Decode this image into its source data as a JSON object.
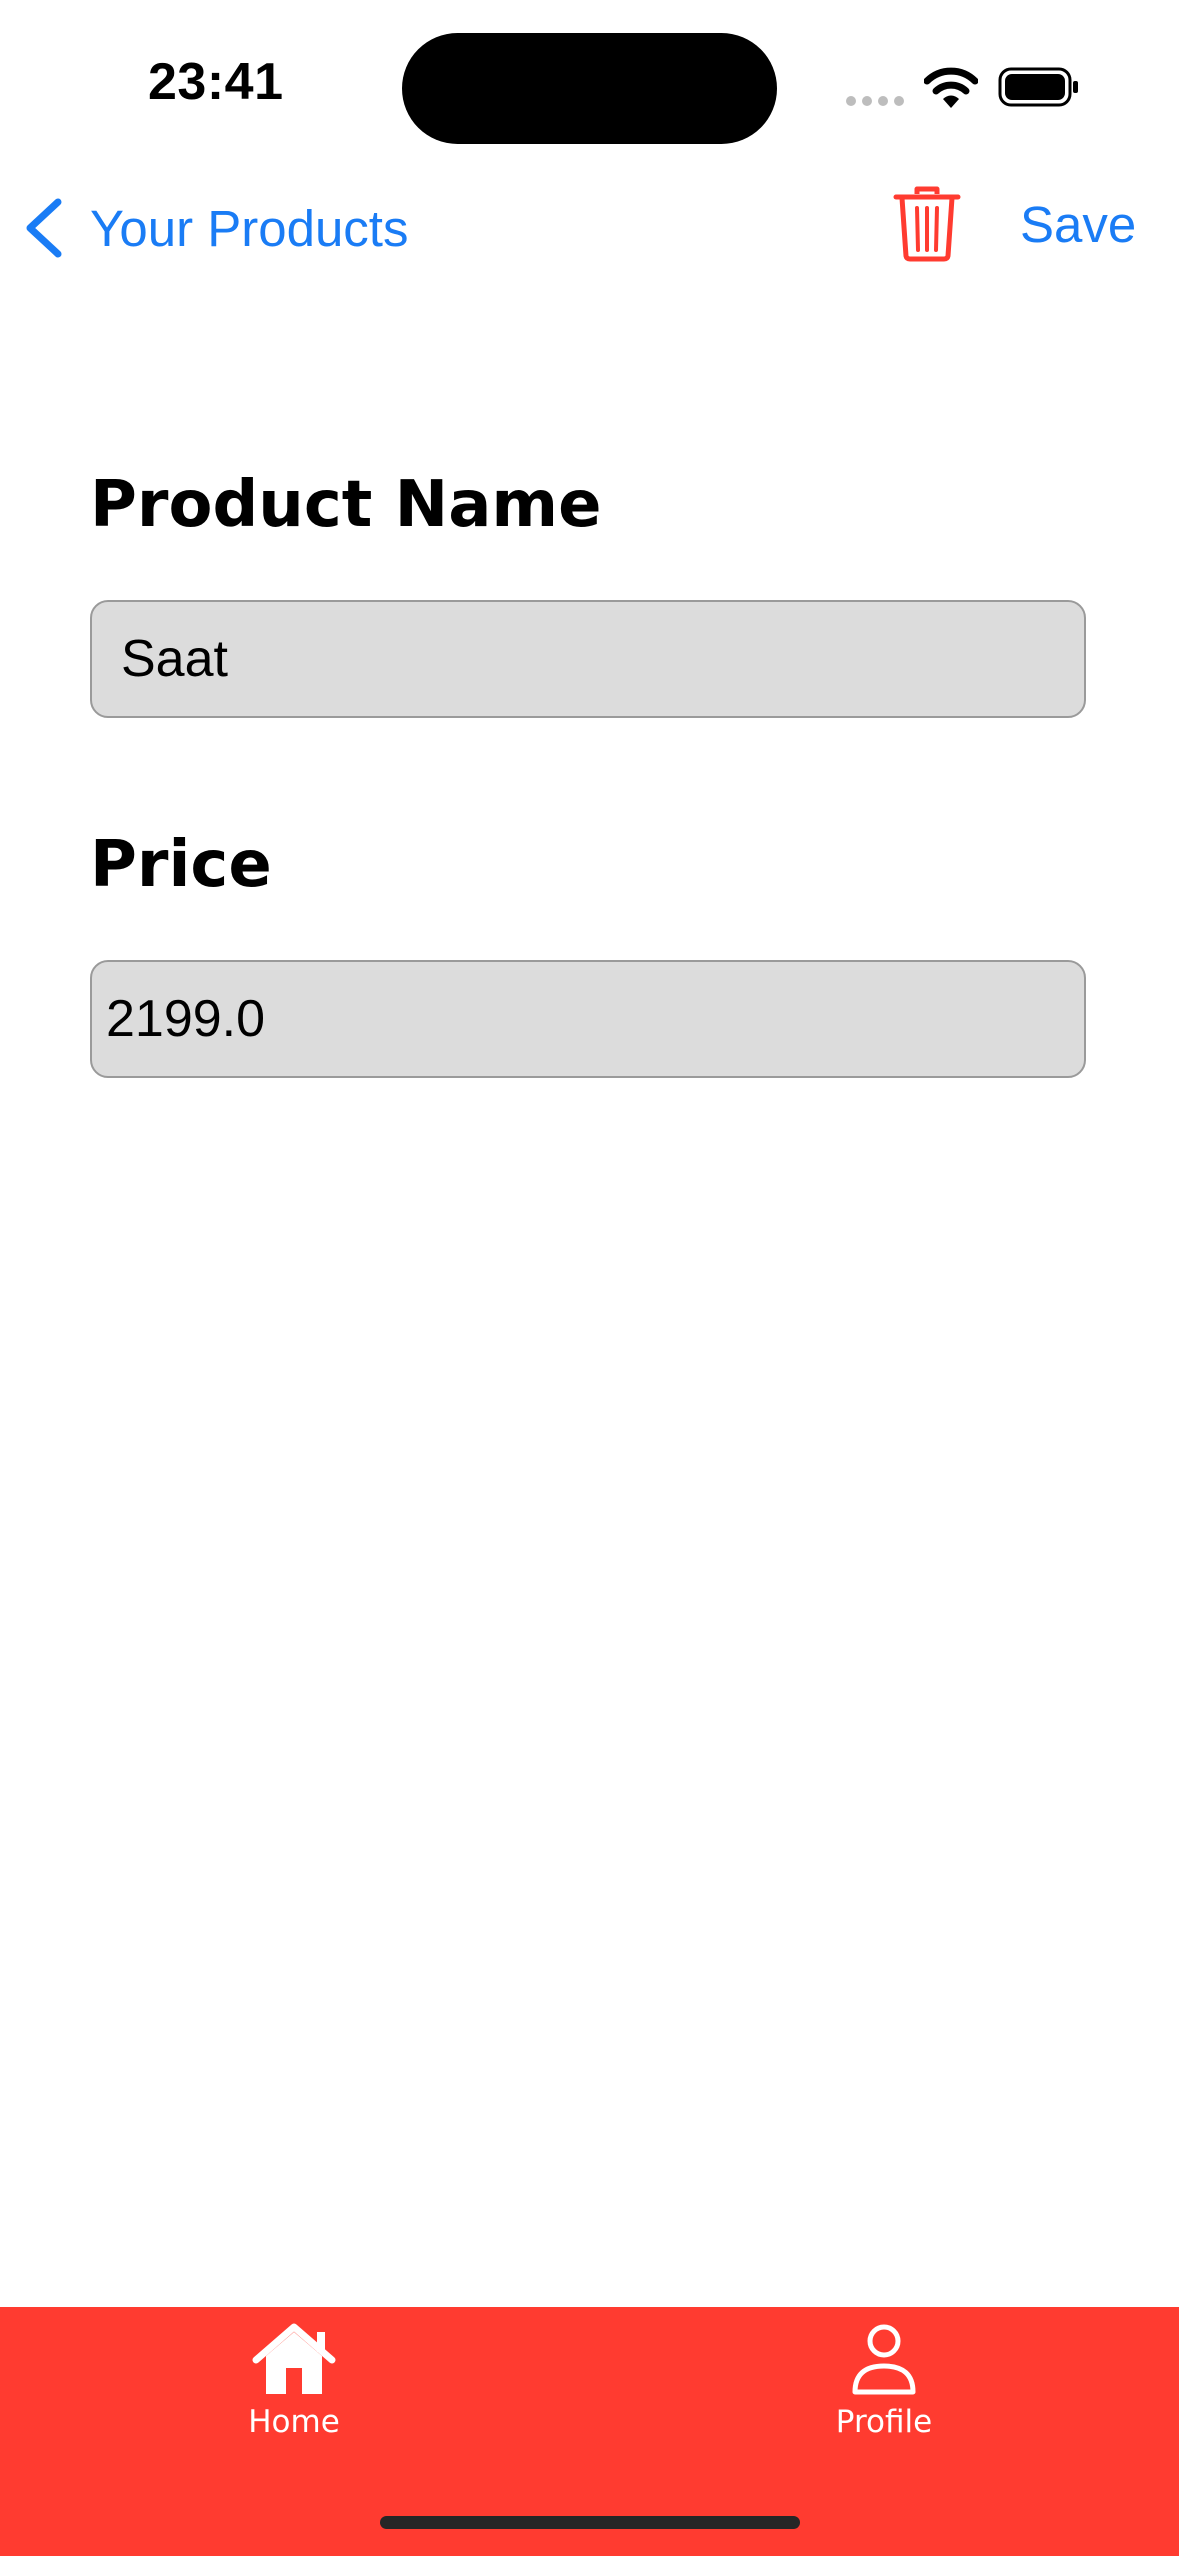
{
  "status_bar": {
    "time": "23:41"
  },
  "nav": {
    "back_label": "Your Products",
    "save_label": "Save",
    "accent_color": "#1a7cf5",
    "delete_color": "#ff3b30"
  },
  "form": {
    "name_label": "Product Name",
    "name_value": "Saat",
    "price_label": "Price",
    "price_value": "2199.0"
  },
  "tabbar": {
    "background_color": "#ff3b30",
    "tabs": [
      {
        "label": "Home",
        "icon": "home-icon"
      },
      {
        "label": "Profile",
        "icon": "person-icon"
      }
    ]
  }
}
